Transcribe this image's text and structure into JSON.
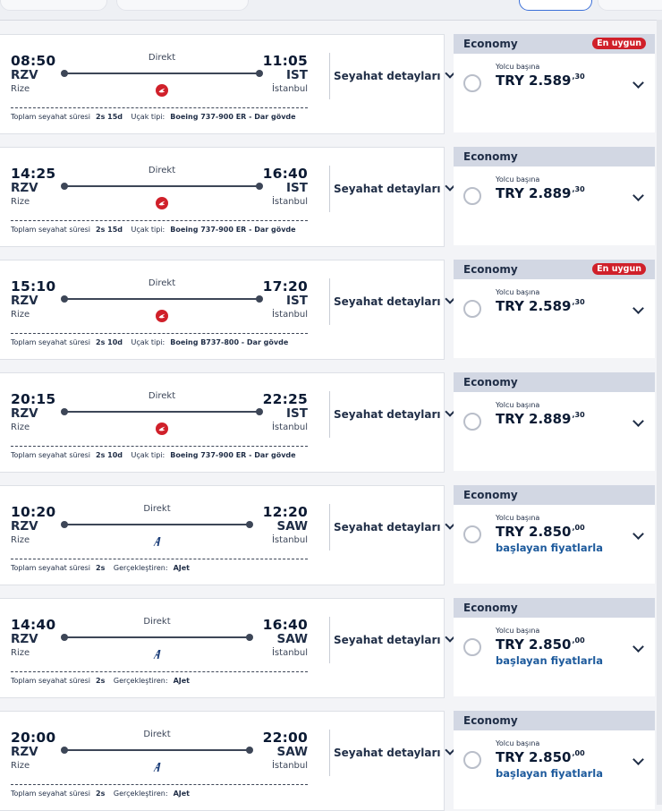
{
  "flights": [
    {
      "dep_time": "08:50",
      "dep_code": "RZV",
      "dep_city": "Rize",
      "arr_time": "11:05",
      "arr_code": "IST",
      "arr_city": "İstanbul",
      "stops": "Direkt",
      "airline_icon": "turkish-airlines-logo",
      "duration_label": "Toplam seyahat süresi",
      "duration": "2s 15d",
      "second_label": "Uçak tipi:",
      "second_value": "Boeing 737-900 ER - Dar gövde",
      "details": "Seyahat detayları",
      "cabin": "Economy",
      "badge": "En uygun",
      "per": "Yolcu başına",
      "price": "TRY 2.589",
      "cents": ",30",
      "from": ""
    },
    {
      "dep_time": "14:25",
      "dep_code": "RZV",
      "dep_city": "Rize",
      "arr_time": "16:40",
      "arr_code": "IST",
      "arr_city": "İstanbul",
      "stops": "Direkt",
      "airline_icon": "turkish-airlines-logo",
      "duration_label": "Toplam seyahat süresi",
      "duration": "2s 15d",
      "second_label": "Uçak tipi:",
      "second_value": "Boeing 737-900 ER - Dar gövde",
      "details": "Seyahat detayları",
      "cabin": "Economy",
      "badge": "",
      "per": "Yolcu başına",
      "price": "TRY 2.889",
      "cents": ",30",
      "from": ""
    },
    {
      "dep_time": "15:10",
      "dep_code": "RZV",
      "dep_city": "Rize",
      "arr_time": "17:20",
      "arr_code": "IST",
      "arr_city": "İstanbul",
      "stops": "Direkt",
      "airline_icon": "turkish-airlines-logo",
      "duration_label": "Toplam seyahat süresi",
      "duration": "2s 10d",
      "second_label": "Uçak tipi:",
      "second_value": "Boeing B737-800 - Dar gövde",
      "details": "Seyahat detayları",
      "cabin": "Economy",
      "badge": "En uygun",
      "per": "Yolcu başına",
      "price": "TRY 2.589",
      "cents": ",30",
      "from": ""
    },
    {
      "dep_time": "20:15",
      "dep_code": "RZV",
      "dep_city": "Rize",
      "arr_time": "22:25",
      "arr_code": "IST",
      "arr_city": "İstanbul",
      "stops": "Direkt",
      "airline_icon": "turkish-airlines-logo",
      "duration_label": "Toplam seyahat süresi",
      "duration": "2s 10d",
      "second_label": "Uçak tipi:",
      "second_value": "Boeing 737-900 ER - Dar gövde",
      "details": "Seyahat detayları",
      "cabin": "Economy",
      "badge": "",
      "per": "Yolcu başına",
      "price": "TRY 2.889",
      "cents": ",30",
      "from": ""
    },
    {
      "dep_time": "10:20",
      "dep_code": "RZV",
      "dep_city": "Rize",
      "arr_time": "12:20",
      "arr_code": "SAW",
      "arr_city": "İstanbul",
      "stops": "Direkt",
      "airline_icon": "ajet-logo",
      "duration_label": "Toplam seyahat süresi",
      "duration": "2s",
      "second_label": "Gerçekleştiren:",
      "second_value": "AJet",
      "details": "Seyahat detayları",
      "cabin": "Economy",
      "badge": "",
      "per": "Yolcu başına",
      "price": "TRY 2.850",
      "cents": ",00",
      "from": "başlayan fiyatlarla"
    },
    {
      "dep_time": "14:40",
      "dep_code": "RZV",
      "dep_city": "Rize",
      "arr_time": "16:40",
      "arr_code": "SAW",
      "arr_city": "İstanbul",
      "stops": "Direkt",
      "airline_icon": "ajet-logo",
      "duration_label": "Toplam seyahat süresi",
      "duration": "2s",
      "second_label": "Gerçekleştiren:",
      "second_value": "AJet",
      "details": "Seyahat detayları",
      "cabin": "Economy",
      "badge": "",
      "per": "Yolcu başına",
      "price": "TRY 2.850",
      "cents": ",00",
      "from": "başlayan fiyatlarla"
    },
    {
      "dep_time": "20:00",
      "dep_code": "RZV",
      "dep_city": "Rize",
      "arr_time": "22:00",
      "arr_code": "SAW",
      "arr_city": "İstanbul",
      "stops": "Direkt",
      "airline_icon": "ajet-logo",
      "duration_label": "Toplam seyahat süresi",
      "duration": "2s",
      "second_label": "Gerçekleştiren:",
      "second_value": "AJet",
      "details": "Seyahat detayları",
      "cabin": "Economy",
      "badge": "",
      "per": "Yolcu başına",
      "price": "TRY 2.850",
      "cents": ",00",
      "from": "başlayan fiyatlarla"
    }
  ],
  "colors": {
    "brand_red": "#d0202a",
    "ajet_blue": "#1d3f7a",
    "link_blue": "#1d5a9c",
    "fare_header": "#d2d7e3"
  }
}
